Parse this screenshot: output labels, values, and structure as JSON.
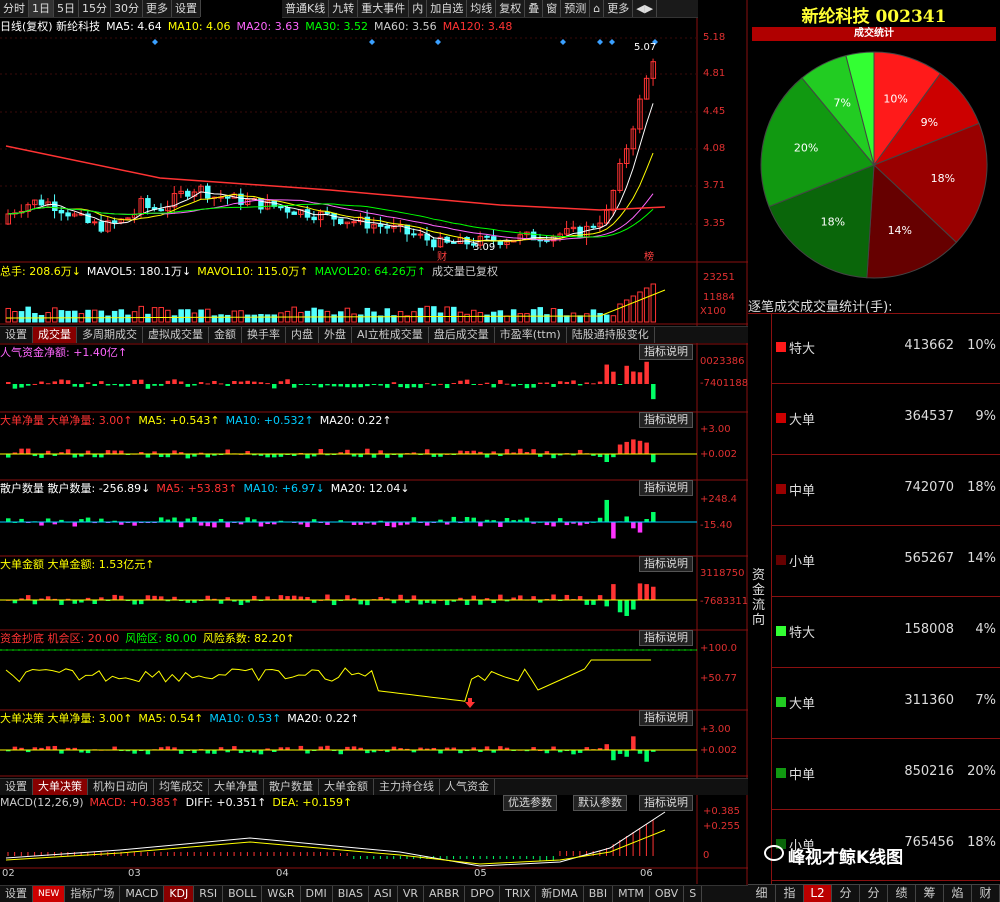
{
  "toolbar": {
    "left": [
      "分时",
      "1日",
      "5日",
      "15分",
      "30分",
      "更多",
      "设置"
    ],
    "right": [
      "普通K线",
      "九转",
      "重大事件",
      "内",
      "加自选",
      "均线",
      "复权",
      "叠",
      "窗",
      "预测",
      "⌂",
      "更多",
      "◀▶"
    ]
  },
  "kline": {
    "header_name": "日线(复权) 新纶科技",
    "ma": [
      {
        "t": "MA5: 4.64",
        "c": "#ffffff"
      },
      {
        "t": "MA10: 4.06",
        "c": "#ffff00"
      },
      {
        "t": "MA20: 3.63",
        "c": "#ff66ff"
      },
      {
        "t": "MA30: 3.52",
        "c": "#00ff00"
      },
      {
        "t": "MA60: 3.56",
        "c": "#cccccc"
      },
      {
        "t": "MA120: 3.48",
        "c": "#ff3333"
      }
    ],
    "axis": [
      "5.18",
      "4.81",
      "4.45",
      "4.08",
      "3.71",
      "3.35"
    ],
    "high_label": "5.07",
    "low_label": "3.09",
    "mark_cai": "财",
    "mark_bang": "榜"
  },
  "volume": {
    "header": [
      {
        "t": "总手: 208.6万↓",
        "c": "#ffff00"
      },
      {
        "t": "MAVOL5: 180.1万↓",
        "c": "#ffffff"
      },
      {
        "t": "MAVOL10: 115.0万↑",
        "c": "#ffff00"
      },
      {
        "t": "MAVOL20: 64.26万↑",
        "c": "#00ff00"
      },
      {
        "t": "成交量已复权",
        "c": "#cccccc"
      }
    ],
    "axis": [
      "23251",
      "11884",
      "X100"
    ]
  },
  "tabs1": [
    "设置",
    "成交量",
    "多周期成交",
    "虚拟成交量",
    "金额",
    "换手率",
    "内盘",
    "外盘",
    "AI立桩成交量",
    "盘后成交量",
    "市盈率(ttm)",
    "陆股通持股变化"
  ],
  "panels": [
    {
      "hdr": [
        {
          "t": "人气资金净额: +1.40亿↑",
          "c": "#ff66ff"
        }
      ],
      "axis": [
        "0023386",
        "-7401188"
      ]
    },
    {
      "hdr": [
        {
          "t": "大单净量 大单净量: 3.00↑",
          "c": "#ff3333"
        },
        {
          "t": "MA5: +0.543↑",
          "c": "#ffff00"
        },
        {
          "t": "MA10: +0.532↑",
          "c": "#00ccff"
        },
        {
          "t": "MA20: 0.22↑",
          "c": "#ffffff"
        }
      ],
      "axis": [
        "+3.00",
        "+0.002"
      ]
    },
    {
      "hdr": [
        {
          "t": "散户数量 散户数量: -256.89↓",
          "c": "#ffffff"
        },
        {
          "t": "MA5: +53.83↑",
          "c": "#ff3333"
        },
        {
          "t": "MA10: +6.97↓",
          "c": "#00ccff"
        },
        {
          "t": "MA20: 12.04↓",
          "c": "#ffffff"
        }
      ],
      "axis": [
        "+248.4",
        "-15.40"
      ]
    },
    {
      "hdr": [
        {
          "t": "大单金额 大单金额: 1.53亿元↑",
          "c": "#ffff00"
        }
      ],
      "axis": [
        "3118750",
        "-7683311"
      ]
    },
    {
      "hdr": [
        {
          "t": "资金抄底 机会区: 20.00",
          "c": "#ff3333"
        },
        {
          "t": "风险区: 80.00",
          "c": "#00ff00"
        },
        {
          "t": "风险系数: 82.20↑",
          "c": "#ffff00"
        }
      ],
      "axis": [
        "+100.0",
        "+50.77"
      ]
    },
    {
      "hdr": [
        {
          "t": "大单决策 大单净量: 3.00↑",
          "c": "#ffff00"
        },
        {
          "t": "MA5: 0.54↑",
          "c": "#ffff00"
        },
        {
          "t": "MA10: 0.53↑",
          "c": "#00ccff"
        },
        {
          "t": "MA20: 0.22↑",
          "c": "#ffffff"
        }
      ],
      "axis": [
        "+3.00",
        "+0.002"
      ]
    }
  ],
  "btn_explain": "指标说明",
  "tabs2": [
    "设置",
    "大单决策",
    "机构日动向",
    "均笔成交",
    "大单净量",
    "散户数量",
    "大单金额",
    "主力持仓线",
    "人气资金"
  ],
  "macd": {
    "hdr": [
      {
        "t": "MACD(12,26,9)",
        "c": "#cccccc"
      },
      {
        "t": "MACD: +0.385↑",
        "c": "#ff3333"
      },
      {
        "t": "DIFF: +0.351↑",
        "c": "#ffffff"
      },
      {
        "t": "DEA: +0.159↑",
        "c": "#ffff00"
      }
    ],
    "btn1": "优选参数",
    "btn2": "默认参数",
    "axis": [
      "+0.385",
      "+0.255",
      "0"
    ],
    "months": [
      "02",
      "03",
      "04",
      "05",
      "06"
    ]
  },
  "tabs3": [
    "设置",
    "NEW",
    "指标广场",
    "MACD",
    "KDJ",
    "RSI",
    "BOLL",
    "W&R",
    "DMI",
    "BIAS",
    "ASI",
    "VR",
    "ARBR",
    "DPO",
    "TRIX",
    "新DMA",
    "BBI",
    "MTM",
    "OBV",
    "S"
  ],
  "right": {
    "title": "新纶科技 002341",
    "pie_title": "成交统计",
    "side_label": "资金流向",
    "stat_title": "逐笔成交成交量统计(手):",
    "rows": [
      {
        "name": "特大",
        "value": "413662",
        "pct": "10%",
        "color": "#ff1a1a"
      },
      {
        "name": "大单",
        "value": "364537",
        "pct": "9%",
        "color": "#cc0000"
      },
      {
        "name": "中单",
        "value": "742070",
        "pct": "18%",
        "color": "#990000"
      },
      {
        "name": "小单",
        "value": "565267",
        "pct": "14%",
        "color": "#660000"
      },
      {
        "name": "特大",
        "value": "158008",
        "pct": "4%",
        "color": "#33ff33"
      },
      {
        "name": "大单",
        "value": "311360",
        "pct": "7%",
        "color": "#22cc22"
      },
      {
        "name": "中单",
        "value": "850216",
        "pct": "20%",
        "color": "#119911"
      },
      {
        "name": "小单",
        "value": "765456",
        "pct": "18%",
        "color": "#0a660a"
      }
    ],
    "pie": [
      {
        "v": 10,
        "c": "#ff1a1a",
        "l": "10%"
      },
      {
        "v": 9,
        "c": "#cc0000",
        "l": "9%"
      },
      {
        "v": 18,
        "c": "#990000",
        "l": "18%"
      },
      {
        "v": 14,
        "c": "#660000",
        "l": "14%"
      },
      {
        "v": 18,
        "c": "#0a660a",
        "l": "18%"
      },
      {
        "v": 20,
        "c": "#119911",
        "l": "20%"
      },
      {
        "v": 7,
        "c": "#22cc22",
        "l": "7%"
      },
      {
        "v": 4,
        "c": "#33ff33",
        "l": ""
      }
    ],
    "bottom_tabs": [
      "细",
      "指",
      "L2",
      "分",
      "分",
      "绩",
      "筹",
      "焰",
      "财"
    ],
    "watermark": "峰视才鲸K线图"
  }
}
